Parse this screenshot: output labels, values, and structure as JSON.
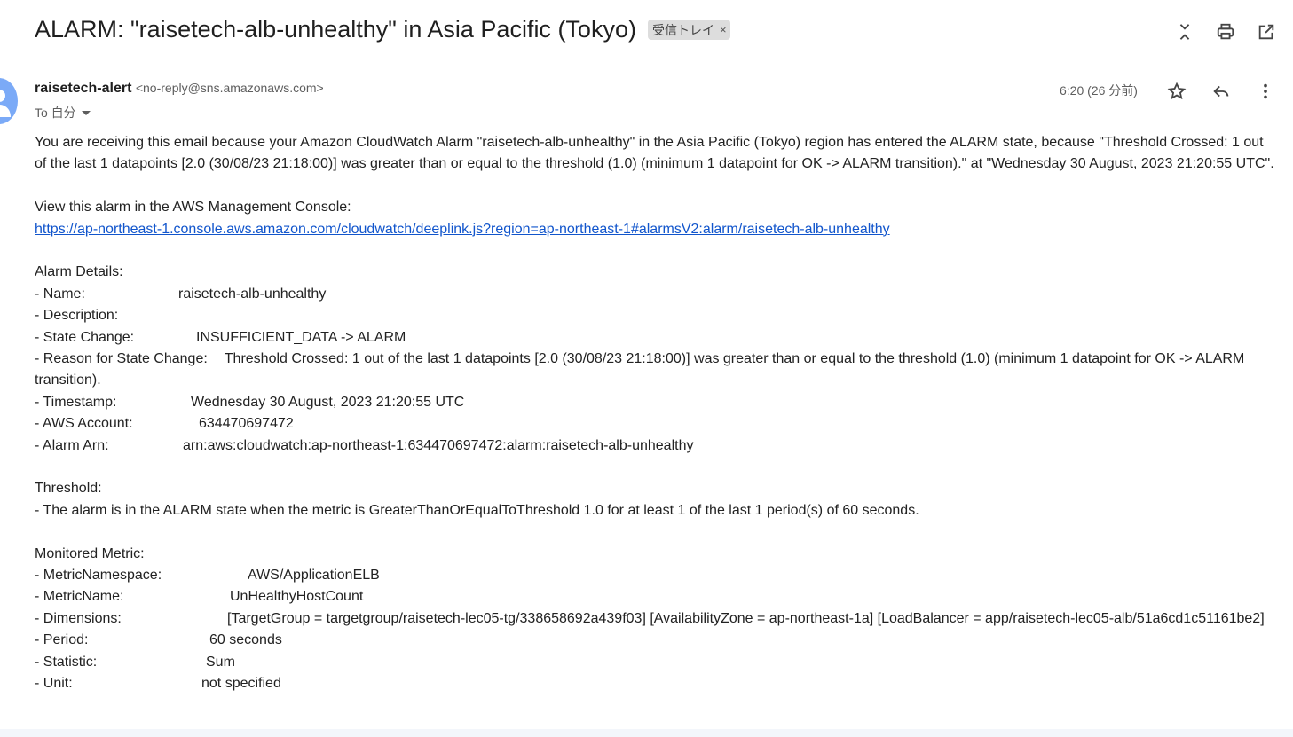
{
  "subject": "ALARM: \"raisetech-alb-unhealthy\" in Asia Pacific (Tokyo)",
  "label": "受信トレイ",
  "label_close": "×",
  "sender": {
    "name": "raisetech-alert",
    "email": "<no-reply@sns.amazonaws.com>",
    "to": "To 自分",
    "time": "6:20 (26 分前)"
  },
  "icons": {
    "collapse": "collapse-icon",
    "print": "print-icon",
    "open_new": "open-in-new-window-icon",
    "star": "star-icon",
    "reply": "reply-icon",
    "more": "more-vert-icon",
    "avatar": "avatar-person-icon"
  },
  "body": {
    "intro": "You are receiving this email because your Amazon CloudWatch Alarm \"raisetech-alb-unhealthy\" in the Asia Pacific (Tokyo) region has entered the ALARM state, because \"Threshold Crossed: 1 out of the last 1 datapoints [2.0 (30/08/23 21:18:00)] was greater than or equal to the threshold (1.0) (minimum 1 datapoint for OK -> ALARM transition).\" at \"Wednesday 30 August, 2023 21:20:55 UTC\".",
    "view_label": "View this alarm in the AWS Management Console:",
    "link": "https://ap-northeast-1.console.aws.amazon.com/cloudwatch/deeplink.js?region=ap-northeast-1#alarmsV2:alarm/raisetech-alb-unhealthy",
    "details_heading": "Alarm Details:",
    "details": {
      "name_k": "- Name:",
      "name_v": "raisetech-alb-unhealthy",
      "description_k": "- Description:",
      "state_k": "- State Change:",
      "state_v": "INSUFFICIENT_DATA -> ALARM",
      "reason_k": "- Reason for State Change:",
      "reason_v": "Threshold Crossed: 1 out of the last 1 datapoints [2.0 (30/08/23 21:18:00)] was greater than or equal to the threshold (1.0) (minimum 1 datapoint for OK -> ALARM transition).",
      "timestamp_k": "- Timestamp:",
      "timestamp_v": "Wednesday 30 August, 2023 21:20:55 UTC",
      "account_k": "- AWS Account:",
      "account_v": "634470697472",
      "arn_k": "- Alarm Arn:",
      "arn_v": "arn:aws:cloudwatch:ap-northeast-1:634470697472:alarm:raisetech-alb-unhealthy"
    },
    "threshold_heading": "Threshold:",
    "threshold_text": "- The alarm is in the ALARM state when the metric is GreaterThanOrEqualToThreshold 1.0 for at least 1 of the last 1 period(s) of 60 seconds.",
    "metric_heading": "Monitored Metric:",
    "metric": {
      "namespace_k": "- MetricNamespace:",
      "namespace_v": "AWS/ApplicationELB",
      "name_k": "- MetricName:",
      "name_v": "UnHealthyHostCount",
      "dimensions_k": "- Dimensions:",
      "dimensions_v": "[TargetGroup = targetgroup/raisetech-lec05-tg/338658692a439f03] [AvailabilityZone = ap-northeast-1a] [LoadBalancer = app/raisetech-lec05-alb/51a6cd1c51161be2]",
      "period_k": "- Period:",
      "period_v": "60 seconds",
      "statistic_k": "- Statistic:",
      "statistic_v": "Sum",
      "unit_k": "- Unit:",
      "unit_v": "not specified"
    }
  }
}
